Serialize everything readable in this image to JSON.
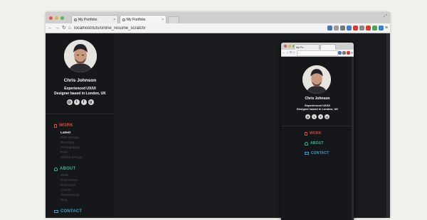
{
  "main_window": {
    "tabs": [
      {
        "title": "My Portfolio"
      },
      {
        "title": "My Portfolio"
      }
    ],
    "url": "localhost/tuts/online_resume_scratch/",
    "nav_icons": [
      "back-arrow-icon",
      "forward-arrow-icon",
      "reload-icon",
      "home-icon",
      "menu-icon"
    ]
  },
  "small_window": {
    "tabs": [
      {
        "title": "My Po..."
      },
      {
        "title": ""
      }
    ],
    "url": "l..."
  },
  "profile": {
    "name": "Chris Johnson",
    "tagline_1": "Experienced UX/UI",
    "tagline_2": "Designer based in London, UK",
    "socials": [
      {
        "icon": "dribbble-icon",
        "glyph": "◎"
      },
      {
        "icon": "twitter-icon",
        "glyph": "t"
      },
      {
        "icon": "facebook-icon",
        "glyph": "f"
      },
      {
        "icon": "googleplus-icon",
        "glyph": "g"
      }
    ]
  },
  "nav": {
    "work": {
      "label": "WORK",
      "items": [
        "Latest",
        "Web Design",
        "Branding",
        "Photography",
        "Print",
        "Mobile Design"
      ],
      "active": "Latest"
    },
    "about": {
      "label": "ABOUT",
      "items": [
        "Skills",
        "Experience",
        "Education",
        "Clients",
        "Testimonials",
        "Blog"
      ]
    },
    "contact": {
      "label": "CONTACT"
    }
  },
  "colors": {
    "work": "#e3463f",
    "about": "#2dbb98",
    "contact": "#3d9fd6",
    "background": "#1a1b1f"
  }
}
